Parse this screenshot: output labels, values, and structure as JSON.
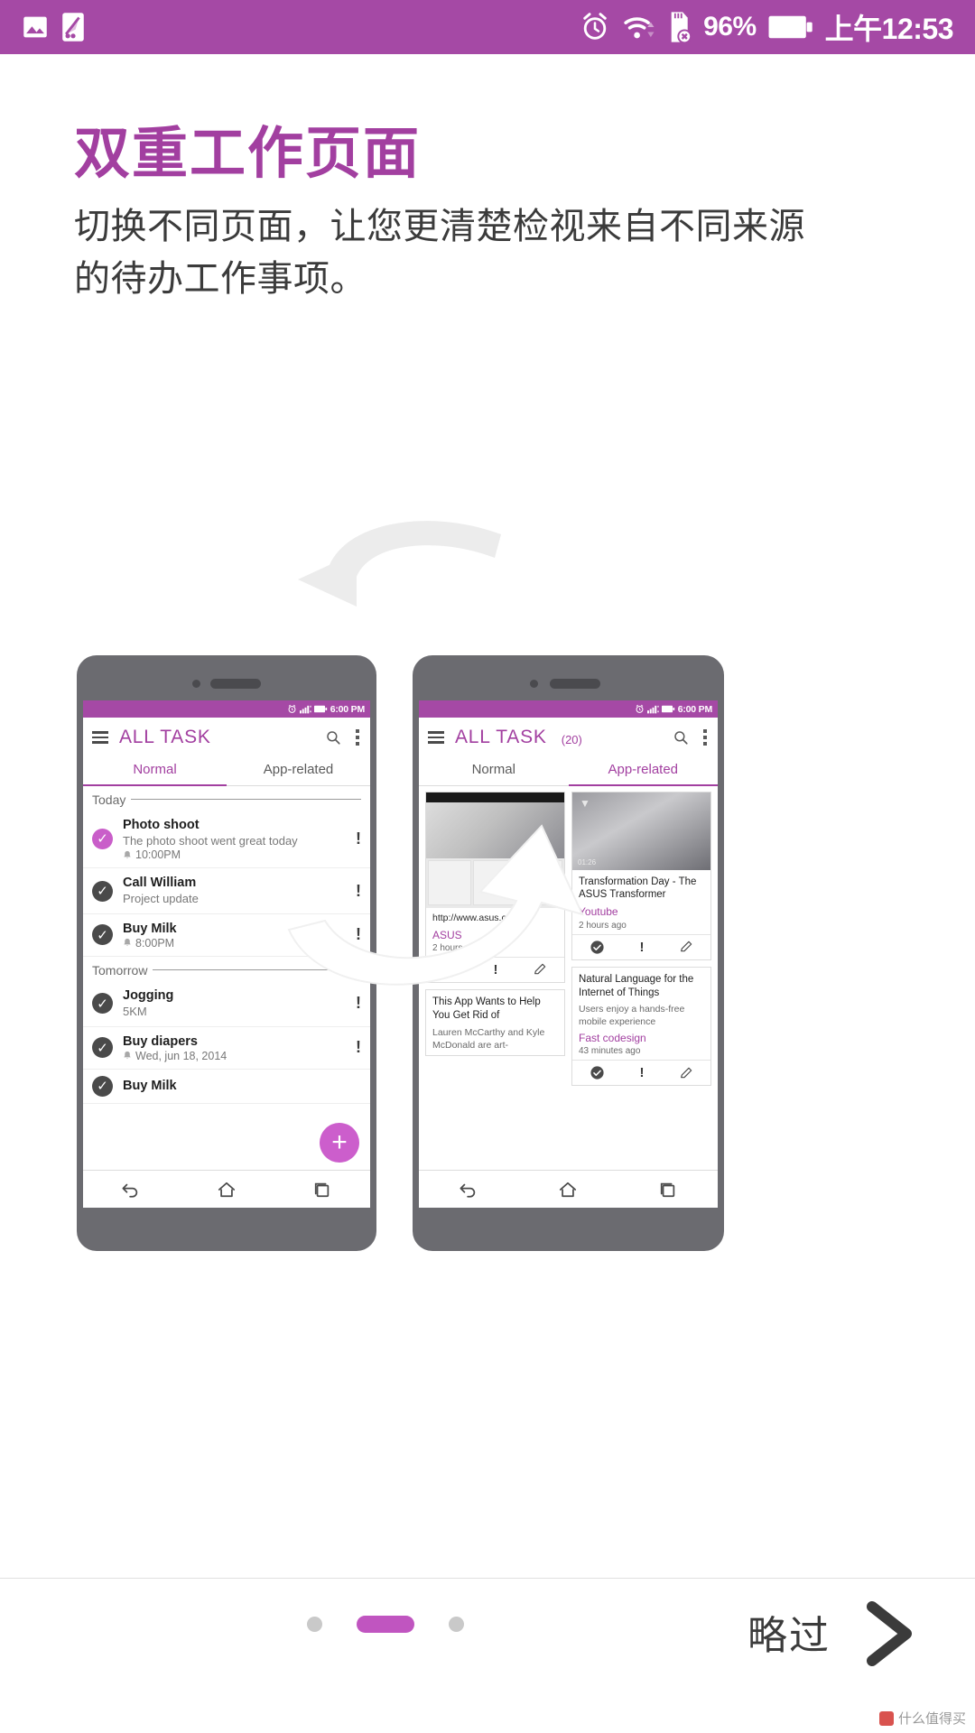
{
  "statusbar": {
    "icons_left": [
      "image-icon",
      "app-icon"
    ],
    "icons_right": [
      "alarm-icon",
      "wifi-icon",
      "sdcard-error-icon",
      "battery-icon"
    ],
    "battery_percent": "96%",
    "time": "上午12:53",
    "bg_color": "#a549a5"
  },
  "intro": {
    "headline": "双重工作页面",
    "subhead": "切换不同页面，让您更清楚检视来自不同来源的待办工作事项。",
    "headline_color": "#a23fa0"
  },
  "phone_left": {
    "mini_status": {
      "time": "6:00 PM"
    },
    "app_title": "ALL TASK",
    "tabs": [
      {
        "label": "Normal",
        "active": true
      },
      {
        "label": "App-related",
        "active": false
      }
    ],
    "sections": [
      {
        "label": "Today",
        "tasks": [
          {
            "title": "Photo shoot",
            "sub": "The photo shoot went great today",
            "meta": "10:00PM",
            "meta_icon": "bell-icon",
            "check": "purple",
            "flag": "!"
          },
          {
            "title": "Call William",
            "sub": "Project update",
            "meta": "",
            "meta_icon": "",
            "check": "dark",
            "flag": "!"
          },
          {
            "title": "Buy Milk",
            "sub": "",
            "meta": "8:00PM",
            "meta_icon": "bell-icon",
            "check": "dark",
            "flag": "!"
          }
        ]
      },
      {
        "label": "Tomorrow",
        "tasks": [
          {
            "title": "Jogging",
            "sub": "5KM",
            "meta": "",
            "meta_icon": "",
            "check": "dark",
            "flag": "!"
          },
          {
            "title": "Buy diapers",
            "sub": "",
            "meta": "Wed, jun 18, 2014",
            "meta_icon": "bell-icon",
            "check": "dark",
            "flag": "!"
          },
          {
            "title": "Buy Milk",
            "sub": "",
            "meta": "",
            "meta_icon": "",
            "check": "dark",
            "flag": ""
          }
        ]
      }
    ],
    "fab": "+",
    "navbar": [
      "back-icon",
      "home-icon",
      "recents-icon"
    ]
  },
  "phone_right": {
    "mini_status": {
      "time": "6:00 PM"
    },
    "app_title": "ALL TASK",
    "app_count": "(20)",
    "tabs": [
      {
        "label": "Normal",
        "active": false
      },
      {
        "label": "App-related",
        "active": true
      }
    ],
    "cards_left": [
      {
        "type": "web",
        "url": "http://www.asus.com",
        "source": "ASUS",
        "time": "2 hours ago",
        "actions": [
          "check-icon",
          "!",
          "edit-icon"
        ]
      },
      {
        "type": "text",
        "title": "This App Wants to Help You Get Rid of",
        "body": "Lauren McCarthy and Kyle McDonald are art-"
      }
    ],
    "cards_right": [
      {
        "type": "photo",
        "duration": "01:26",
        "title": "Transformation Day - The ASUS Transformer",
        "source": "Youtube",
        "time": "2 hours ago",
        "actions": [
          "check-icon",
          "!",
          "edit-icon"
        ]
      },
      {
        "type": "text",
        "title": "Natural Language for the Internet of Things",
        "body": "Users enjoy a hands-free mobile experience",
        "source": "Fast codesign",
        "time": "43 minutes ago",
        "actions": [
          "check-icon",
          "!",
          "edit-icon"
        ]
      }
    ],
    "navbar": [
      "back-icon",
      "home-icon",
      "recents-icon"
    ]
  },
  "footer": {
    "dots": [
      {
        "active": false
      },
      {
        "active": true
      },
      {
        "active": false
      }
    ],
    "skip_label": "略过",
    "next_icon": "chevron-right-icon",
    "accent_color": "#c055c0"
  },
  "watermark": {
    "text": "什么值得买"
  }
}
